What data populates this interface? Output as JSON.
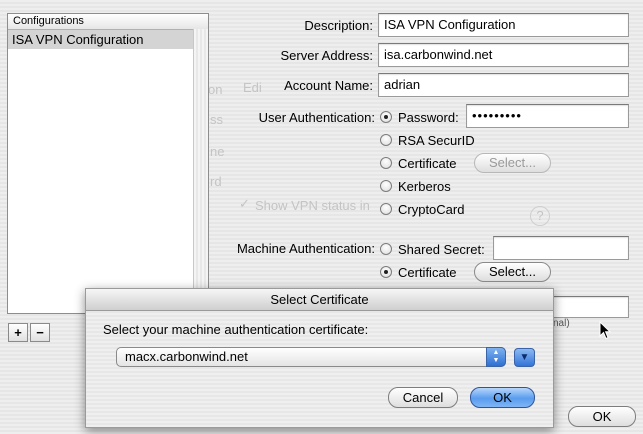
{
  "configurations": {
    "header": "Configurations",
    "items": [
      "ISA VPN Configuration"
    ],
    "add_label": "+",
    "remove_label": "−"
  },
  "form": {
    "description_label": "Description:",
    "description_value": "ISA VPN Configuration",
    "server_label": "Server Address:",
    "server_value": "isa.carbonwind.net",
    "account_label": "Account Name:",
    "account_value": "adrian",
    "user_auth": {
      "label": "User Authentication:",
      "options": [
        "Password:",
        "RSA SecurID",
        "Certificate",
        "Kerberos",
        "CryptoCard"
      ],
      "selected": "Password:",
      "password_value": "•••••••••",
      "certificate_select": "Select..."
    },
    "machine_auth": {
      "label": "Machine Authentication:",
      "options": [
        "Shared Secret:",
        "Certificate"
      ],
      "selected": "Certificate",
      "shared_secret_value": "",
      "certificate_select": "Select..."
    }
  },
  "background_ghost": {
    "show_vpn_status": "Show VPN status in",
    "edit_hint": "Edi",
    "on_hint": "on",
    "ss_hint": "ss",
    "ne_hint": "ne",
    "rd_hint": "rd",
    "nal_hint": "nal)"
  },
  "sheet": {
    "title": "Select Certificate",
    "prompt": "Select your machine authentication certificate:",
    "selected_certificate": "macx.carbonwind.net",
    "cancel_label": "Cancel",
    "ok_label": "OK"
  },
  "main_ok_label": "OK"
}
